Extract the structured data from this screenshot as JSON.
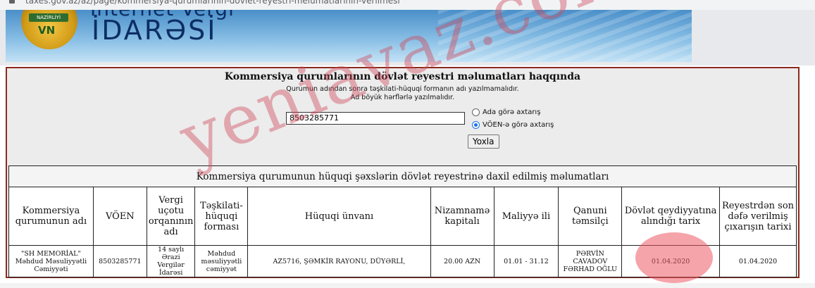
{
  "browser": {
    "url": "taxes.gov.az/az/page/kommersiya-qurumlarinin-dovlet-reyestri-melumatlarinin-verilmesi"
  },
  "banner": {
    "emblem_text": "NAZİRLİYİ",
    "emblem_letters": "VN",
    "title_top": "İnternet Vergi",
    "title": "İDARƏSİ"
  },
  "search": {
    "heading": "Kommersiya qurumlarının dövlət reyestri məlumatları haqqında",
    "note1": "Qurumun adından sonra təşkilati-hüquqi formanın adı yazılmamalıdır.",
    "note2": "Ad böyük hərflərlə yazılmalıdır.",
    "input_value": "8503285771",
    "radio_name_label": "Ada görə axtarış",
    "radio_voen_label": "VÖEN-ə görə axtarış",
    "selected": "voen",
    "button_label": "Yoxla"
  },
  "table": {
    "caption": "Kommersiya qurumunun hüquqi şəxslərin dövlət reyestrinə daxil edilmiş məlumatları",
    "headers": [
      "Kommersiya qurumunun adı",
      "VÖEN",
      "Vergi uçotu orqanının adı",
      "Təşkilati-hüquqi forması",
      "Hüquqi ünvanı",
      "Nizamnamə kapitalı",
      "Maliyyə ili",
      "Qanuni təmsilçi",
      "Dövlət qeydiyyatına alındığı tarix",
      "Reyestrdən son dəfə verilmiş çıxarışın tarixi"
    ],
    "rows": [
      [
        "\"SH MEMORİAL\" Məhdud Məsuliyyətli Cəmiyyəti",
        "8503285771",
        "14 saylı Ərazi Vergilər İdarəsi",
        "Məhdud məsuliyyətli cəmiyyət",
        "AZ5716, ŞƏMKİR RAYONU, DÜYƏRLİ,",
        "20.00 AZN",
        "01.01 - 31.12",
        "PƏRVİN CAVADOV FƏRHAD OĞLU",
        "01.04.2020",
        "01.04.2020"
      ]
    ]
  },
  "watermark": "yeniavaz.com",
  "colors": {
    "border": "#8b2b1f",
    "panel_bg": "#ececec",
    "watermark": "#cd4658",
    "highlight": "#ec5a64",
    "banner_blue": "#4a8fc9"
  }
}
